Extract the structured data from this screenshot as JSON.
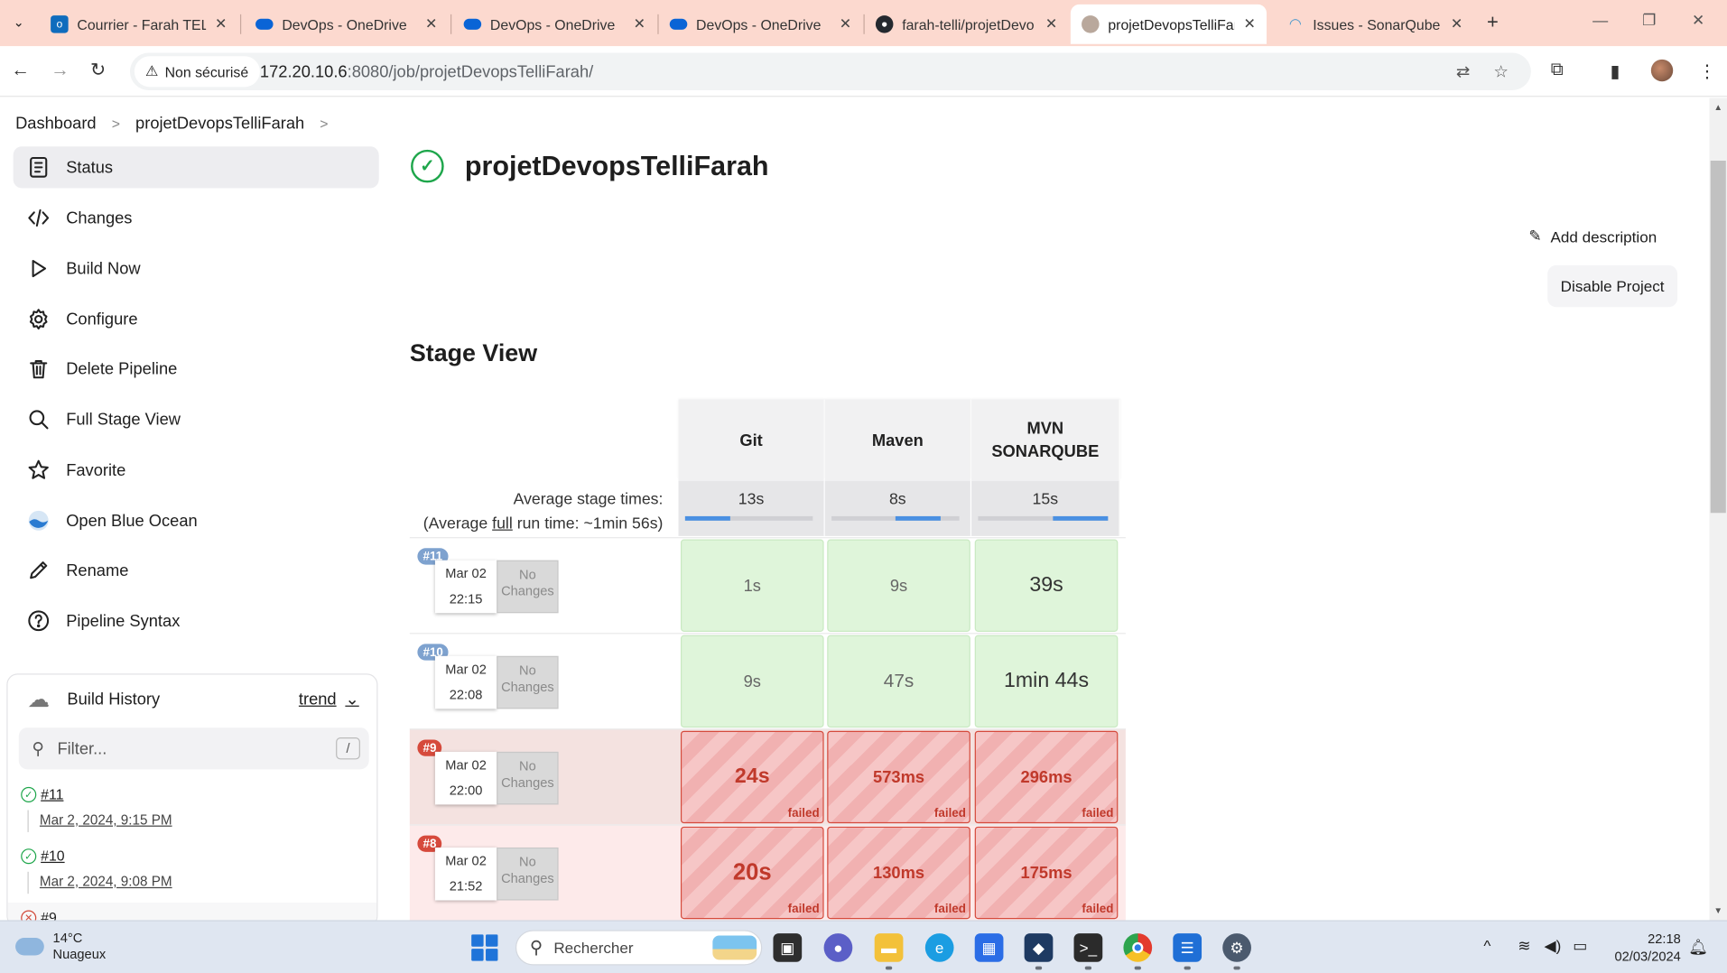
{
  "browser": {
    "tabs": [
      {
        "label": "Courrier - Farah TELLI",
        "icon": "outlook-icon",
        "color": "#0f6cbd"
      },
      {
        "label": "DevOps - OneDrive",
        "icon": "onedrive-icon",
        "color": "#0a64d6"
      },
      {
        "label": "DevOps - OneDrive",
        "icon": "onedrive-icon",
        "color": "#0a64d6"
      },
      {
        "label": "DevOps - OneDrive",
        "icon": "onedrive-icon",
        "color": "#0a64d6"
      },
      {
        "label": "farah-telli/projetDevo",
        "icon": "github-icon",
        "color": "#24292f"
      },
      {
        "label": "projetDevopsTelliFarah",
        "icon": "jenkins-icon",
        "color": "#7a7a7a"
      },
      {
        "label": "Issues - SonarQube",
        "icon": "sonarqube-icon",
        "color": "#4e9bcd"
      }
    ],
    "security_label": "Non sécurisé",
    "url_host": "172.20.10.6",
    "url_rest": ":8080/job/projetDevopsTelliFarah/"
  },
  "breadcrumb": {
    "items": [
      "Dashboard",
      "projetDevopsTelliFarah"
    ]
  },
  "sidebar": {
    "items": [
      {
        "label": "Status",
        "icon": "status-icon"
      },
      {
        "label": "Changes",
        "icon": "code-icon"
      },
      {
        "label": "Build Now",
        "icon": "play-icon"
      },
      {
        "label": "Configure",
        "icon": "gear-icon"
      },
      {
        "label": "Delete Pipeline",
        "icon": "trash-icon"
      },
      {
        "label": "Full Stage View",
        "icon": "search-icon"
      },
      {
        "label": "Favorite",
        "icon": "star-icon"
      },
      {
        "label": "Open Blue Ocean",
        "icon": "blue-ocean-icon"
      },
      {
        "label": "Rename",
        "icon": "pencil-icon"
      },
      {
        "label": "Pipeline Syntax",
        "icon": "help-icon"
      }
    ]
  },
  "build_history": {
    "title": "Build History",
    "trend_label": "trend",
    "filter_placeholder": "Filter...",
    "filter_shortcut": "/",
    "builds": [
      {
        "number": "#11",
        "date": "Mar 2, 2024, 9:15 PM",
        "status": "success"
      },
      {
        "number": "#10",
        "date": "Mar 2, 2024, 9:08 PM",
        "status": "success"
      },
      {
        "number": "#9",
        "date": "",
        "status": "failed"
      }
    ]
  },
  "main": {
    "title": "projetDevopsTelliFarah",
    "add_description": "Add description",
    "disable_project": "Disable Project",
    "stage_view_title": "Stage View"
  },
  "stage_view": {
    "stages": [
      "Git",
      "Maven",
      "MVN SONARQUBE"
    ],
    "avg_label_line1": "Average stage times:",
    "avg_label_pre": "(Average ",
    "avg_label_link": "full",
    "avg_label_post": " run time: ~1min 56s)",
    "avg_times": [
      "13s",
      "8s",
      "15s"
    ],
    "avg_progress": [
      0.35,
      0.35,
      0.42
    ],
    "no_changes": "No Changes",
    "failed_label": "failed",
    "runs": [
      {
        "number": "#11",
        "date": "Mar 02",
        "time": "22:15",
        "status": "success",
        "durations": [
          "1s",
          "9s",
          "39s"
        ]
      },
      {
        "number": "#10",
        "date": "Mar 02",
        "time": "22:08",
        "status": "success",
        "durations": [
          "9s",
          "47s",
          "1min 44s"
        ]
      },
      {
        "number": "#9",
        "date": "Mar 02",
        "time": "22:00",
        "status": "failed",
        "durations": [
          "24s",
          "573ms",
          "296ms"
        ]
      },
      {
        "number": "#8",
        "date": "Mar 02",
        "time": "21:52",
        "status": "failed",
        "durations": [
          "20s",
          "130ms",
          "175ms"
        ]
      }
    ]
  },
  "taskbar": {
    "weather_temp": "14°C",
    "weather_desc": "Nuageux",
    "search_placeholder": "Rechercher",
    "time": "22:18",
    "date": "02/03/2024"
  }
}
